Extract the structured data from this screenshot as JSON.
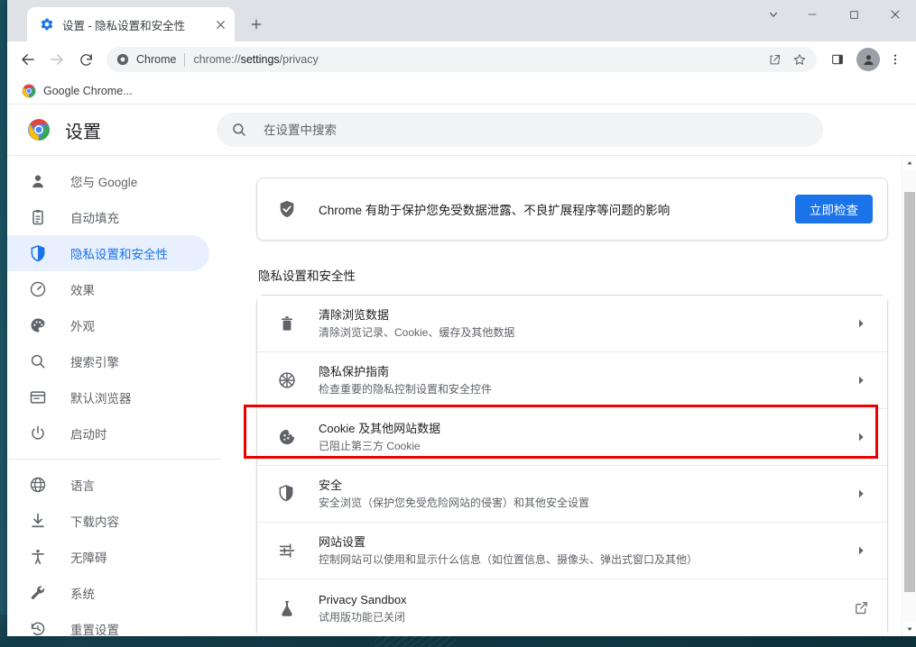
{
  "window": {
    "controls": [
      {
        "name": "tab-search",
        "glyph": "chevron-down"
      },
      {
        "name": "minimize",
        "glyph": "minimize"
      },
      {
        "name": "maximize",
        "glyph": "maximize"
      },
      {
        "name": "close",
        "glyph": "close"
      }
    ]
  },
  "tabs": [
    {
      "title": "设置 - 隐私设置和安全性",
      "favicon": "gear-icon",
      "close_label": "×"
    }
  ],
  "new_tab_label": "+",
  "toolbar": {
    "back_label": "←",
    "forward_label": "→",
    "reload_label": "⟳",
    "omnibox": {
      "chip_label": "Chrome",
      "url_scheme": "chrome://",
      "url_strong": "settings",
      "url_tail": "/privacy",
      "full_url": "chrome://settings/privacy"
    },
    "actions": [
      "share-icon",
      "bookmark-star-icon",
      "side-panel-icon",
      "profile-avatar-icon",
      "more-menu-icon"
    ]
  },
  "bookmarks": [
    {
      "label": "Google Chrome...",
      "icon": "chrome-logo-icon"
    }
  ],
  "settings": {
    "title": "设置",
    "logo": "chrome-logo-icon",
    "search": {
      "placeholder": "在设置中搜索",
      "value": "",
      "icon": "search-icon"
    }
  },
  "sidebar": {
    "groups": [
      {
        "items": [
          {
            "label": "您与 Google",
            "icon": "person-icon",
            "active": false
          },
          {
            "label": "自动填充",
            "icon": "clipboard-icon",
            "active": false
          },
          {
            "label": "隐私设置和安全性",
            "icon": "shield-icon",
            "active": true
          },
          {
            "label": "效果",
            "icon": "speedometer-icon",
            "active": false
          },
          {
            "label": "外观",
            "icon": "palette-icon",
            "active": false
          },
          {
            "label": "搜索引擎",
            "icon": "search-icon",
            "active": false
          },
          {
            "label": "默认浏览器",
            "icon": "browser-window-icon",
            "active": false
          },
          {
            "label": "启动时",
            "icon": "power-icon",
            "active": false
          }
        ]
      },
      {
        "items": [
          {
            "label": "语言",
            "icon": "globe-icon",
            "active": false
          },
          {
            "label": "下载内容",
            "icon": "download-icon",
            "active": false
          },
          {
            "label": "无障碍",
            "icon": "accessibility-icon",
            "active": false
          },
          {
            "label": "系统",
            "icon": "wrench-icon",
            "active": false
          },
          {
            "label": "重置设置",
            "icon": "history-restore-icon",
            "active": false
          }
        ]
      }
    ]
  },
  "main": {
    "safety_check": {
      "icon": "shield-check-icon",
      "text": "Chrome 有助于保护您免受数据泄露、不良扩展程序等问题的影响",
      "button_label": "立即检查"
    },
    "section_title": "隐私设置和安全性",
    "rows": [
      {
        "icon": "trash-icon",
        "title": "清除浏览数据",
        "subtitle": "清除浏览记录、Cookie、缓存及其他数据",
        "trailing": "chevron-right-icon",
        "highlighted": false
      },
      {
        "icon": "privacy-guide-icon",
        "title": "隐私保护指南",
        "subtitle": "检查重要的隐私控制设置和安全控件",
        "trailing": "chevron-right-icon",
        "highlighted": false
      },
      {
        "icon": "cookie-icon",
        "title": "Cookie 及其他网站数据",
        "subtitle": "已阻止第三方 Cookie",
        "trailing": "chevron-right-icon",
        "highlighted": true
      },
      {
        "icon": "shield-icon",
        "title": "安全",
        "subtitle": "安全浏览（保护您免受危险网站的侵害）和其他安全设置",
        "trailing": "chevron-right-icon",
        "highlighted": false
      },
      {
        "icon": "tune-sliders-icon",
        "title": "网站设置",
        "subtitle": "控制网站可以使用和显示什么信息（如位置信息、摄像头、弹出式窗口及其他）",
        "trailing": "chevron-right-icon",
        "highlighted": false
      },
      {
        "icon": "flask-icon",
        "title": "Privacy Sandbox",
        "subtitle": "试用版功能已关闭",
        "trailing": "open-in-new-icon",
        "highlighted": false
      }
    ]
  },
  "colors": {
    "accent": "#1a73e8",
    "active_nav_bg": "#e8f0fe",
    "highlight": "#ee0000",
    "text_primary": "#202124",
    "text_secondary": "#5f6368",
    "tabstrip_bg": "#dee1e6",
    "desktop_bg": "#17505f"
  }
}
